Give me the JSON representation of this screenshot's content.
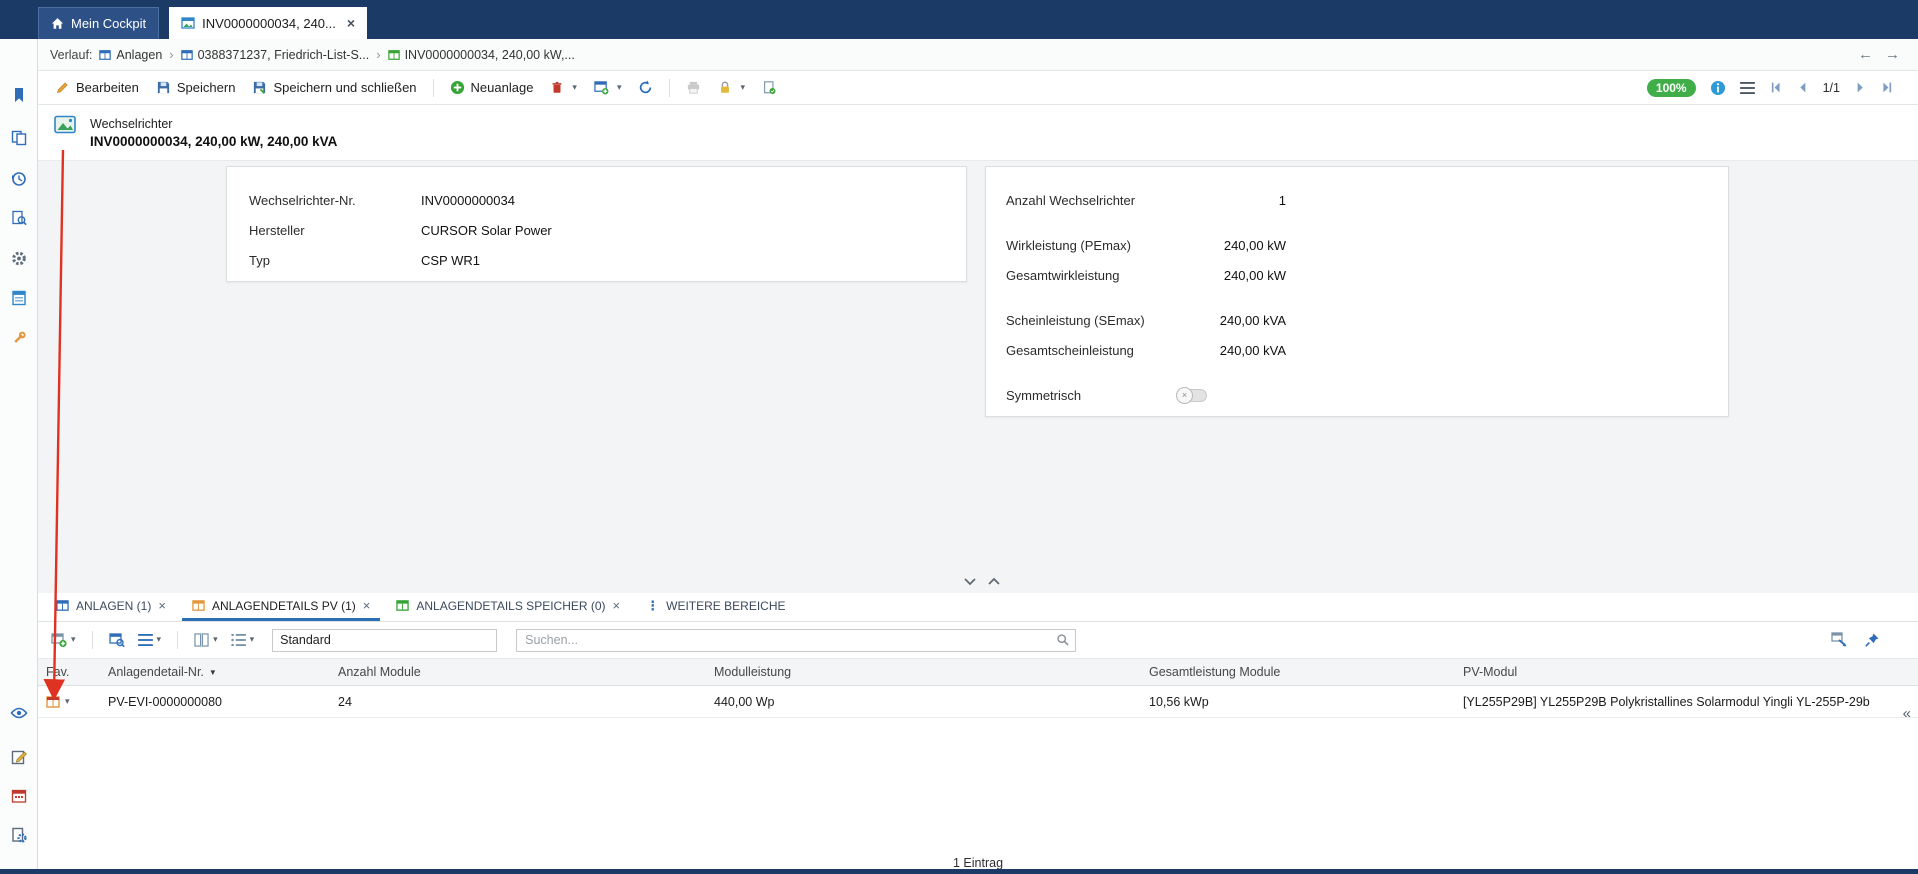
{
  "colors": {
    "topbar": "#1b3a66",
    "accent_blue": "#2a6fb5",
    "success_green": "#3fae49",
    "warning_orange": "#e2973c",
    "danger_red": "#c0392b",
    "annotation_red": "#e03222"
  },
  "glyphs": {
    "close": "×",
    "caret": "▾",
    "crumb_sep": "›",
    "back": "←",
    "forward": "→",
    "overflow": "⋮",
    "collapse": "«",
    "sort": "▼",
    "toggle_off": "×"
  },
  "top_tabs": {
    "home": "Mein Cockpit",
    "record": "INV0000000034, 240..."
  },
  "breadcrumb": {
    "label": "Verlauf:",
    "items": [
      "Anlagen",
      "0388371237, Friedrich-List-S...",
      "INV0000000034, 240,00 kW,..."
    ]
  },
  "toolbar": {
    "edit": "Bearbeiten",
    "save": "Speichern",
    "save_close": "Speichern und schließen",
    "new": "Neuanlage",
    "zoom": "100%",
    "page_indicator": "1/1"
  },
  "record_header": {
    "type": "Wechselrichter",
    "title": "INV0000000034, 240,00 kW, 240,00 kVA"
  },
  "details_left": {
    "fields": [
      {
        "label": "Wechselrichter-Nr.",
        "value": "INV0000000034"
      },
      {
        "label": "Hersteller",
        "value": "CURSOR Solar Power"
      },
      {
        "label": "Typ",
        "value": "CSP WR1"
      }
    ]
  },
  "details_right": {
    "fields": [
      {
        "label": "Anzahl Wechselrichter",
        "value": "1"
      },
      {
        "label": "Wirkleistung (PEmax)",
        "value": "240,00 kW"
      },
      {
        "label": "Gesamtwirkleistung",
        "value": "240,00 kW"
      },
      {
        "label": "Scheinleistung (SEmax)",
        "value": "240,00 kVA"
      },
      {
        "label": "Gesamtscheinleistung",
        "value": "240,00 kVA"
      },
      {
        "label": "Symmetrisch",
        "value": ""
      }
    ]
  },
  "bottom_tabs": [
    "ANLAGEN (1)",
    "ANLAGENDETAILS PV (1)",
    "ANLAGENDETAILS SPEICHER (0)",
    "WEITERE BEREICHE"
  ],
  "grid_toolbar": {
    "view": "Standard",
    "search_placeholder": "Suchen..."
  },
  "grid": {
    "columns": [
      "Fav.",
      "Anlagendetail-Nr.",
      "Anzahl Module",
      "Modulleistung",
      "Gesamtleistung Module",
      "PV-Modul"
    ],
    "rows": [
      [
        "PV-EVI-0000000080",
        "24",
        "440,00 Wp",
        "10,56 kWp",
        "[YL255P29B] YL255P29B Polykristallines Solarmodul Yingli YL-255P-29b"
      ]
    ],
    "footer": "1 Eintrag"
  }
}
